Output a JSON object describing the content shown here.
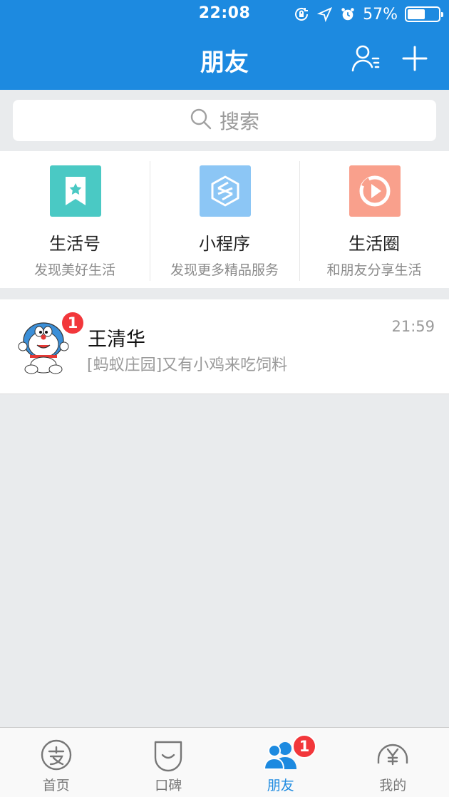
{
  "status_bar": {
    "time": "22:08",
    "battery_percent": "57%",
    "battery_level": 0.57,
    "icons": [
      "rotation-lock-icon",
      "location-arrow-icon",
      "alarm-icon",
      "battery-icon"
    ]
  },
  "header": {
    "title": "朋友",
    "contacts_icon": "contacts-icon",
    "add_icon": "plus-icon",
    "color": "#1d8ae0"
  },
  "search": {
    "placeholder": "搜索",
    "icon": "search-icon"
  },
  "services": [
    {
      "title": "生活号",
      "subtitle": "发现美好生活",
      "icon": "bookmark-star-icon",
      "color": "#4ac9c4"
    },
    {
      "title": "小程序",
      "subtitle": "发现更多精品服务",
      "icon": "mini-program-icon",
      "color": "#8cc6f5"
    },
    {
      "title": "生活圈",
      "subtitle": "和朋友分享生活",
      "icon": "play-circle-icon",
      "color": "#f9a08c"
    }
  ],
  "chats": [
    {
      "name": "王清华",
      "time": "21:59",
      "preview": "[蚂蚁庄园]又有小鸡来吃饲料",
      "unread": "1",
      "avatar": "doraemon-avatar"
    }
  ],
  "tabbar": {
    "items": [
      {
        "label": "首页",
        "icon": "alipay-home-icon"
      },
      {
        "label": "口碑",
        "icon": "koubei-icon"
      },
      {
        "label": "朋友",
        "icon": "friends-icon",
        "active": true,
        "badge": "1"
      },
      {
        "label": "我的",
        "icon": "wallet-icon"
      }
    ],
    "active_color": "#1d8ae0",
    "badge_color": "#f2373b"
  }
}
